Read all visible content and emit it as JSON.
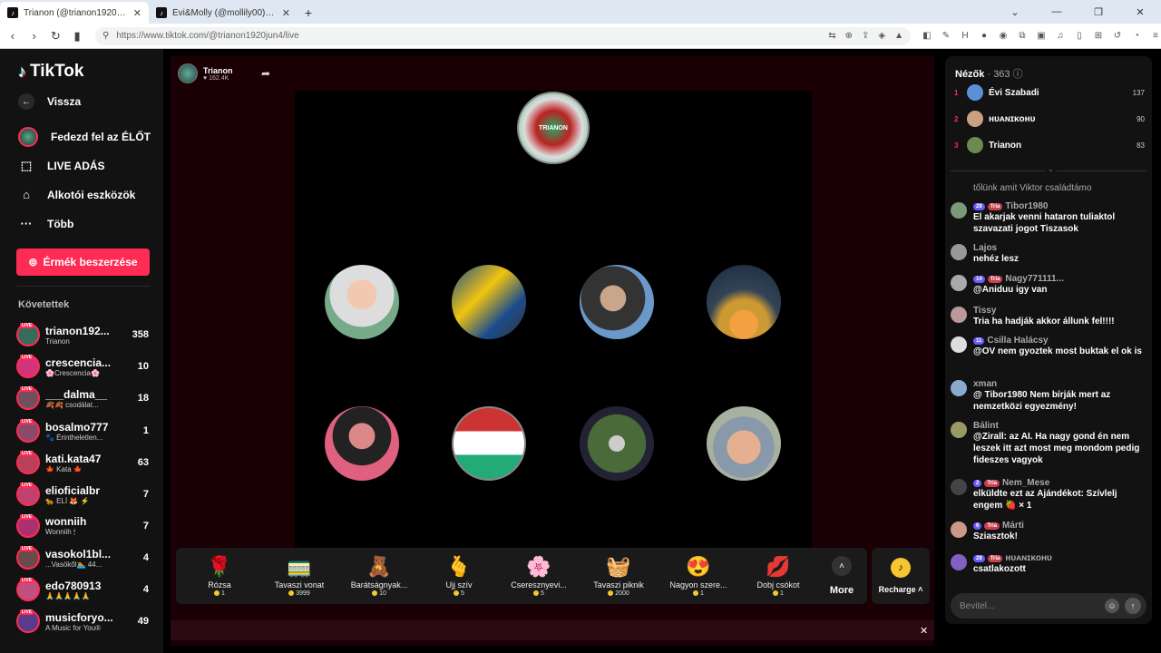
{
  "browser": {
    "tabs": [
      {
        "title": "Trianon (@trianon1920jun4) ÉLŐ adásban",
        "active": true
      },
      {
        "title": "Évi&Molly (@mollily00) ÉLŐ adásban",
        "active": false
      }
    ],
    "url": "https://www.tiktok.com/@trianon1920jun4/live"
  },
  "sidebar": {
    "brand": "TikTok",
    "nav": [
      {
        "label": "Vissza",
        "icon": "back-arrow-icon"
      },
      {
        "label": "Fedezd fel az ÉLŐT",
        "icon": "avatar-icon"
      },
      {
        "label": "LIVE ADÁS",
        "icon": "camera-icon"
      },
      {
        "label": "Alkotói eszközök",
        "icon": "play-icon"
      },
      {
        "label": "Több",
        "icon": "ellipsis-icon"
      }
    ],
    "coins_button": "Érmék beszerzése",
    "followed_title": "Követettek",
    "live_tag": "LIVE",
    "followed": [
      {
        "name": "trianon192...",
        "sub": "Trianon",
        "count": "358"
      },
      {
        "name": "crescencia...",
        "sub": "🌸Crescencia🌸",
        "count": "10"
      },
      {
        "name": "___dalma__",
        "sub": "🍂🍂 csodálat...",
        "count": "18"
      },
      {
        "name": "bosalmo777",
        "sub": "🐾 Érintheletlen...",
        "count": "1"
      },
      {
        "name": "kati.kata47",
        "sub": "🍁 Kata 🍁",
        "count": "63"
      },
      {
        "name": "elioficialbr",
        "sub": "🐆 ELÍ 🦊 ⚡",
        "count": "7"
      },
      {
        "name": "wonniih",
        "sub": "Wonniih 🕯",
        "count": "7"
      },
      {
        "name": "vasokol1bl...",
        "sub": "...Vasökől🏊 44...",
        "count": "4"
      },
      {
        "name": "edo780913",
        "sub": "🙏🙏🙏🙏🙏",
        "count": "4"
      },
      {
        "name": "musicforyo...",
        "sub": "A Music for You®",
        "count": "49"
      }
    ]
  },
  "stream": {
    "host_name": "Trianon",
    "host_likes": "162.4K",
    "emblem_text": "TRIANON"
  },
  "gifts": [
    {
      "name": "Rózsa",
      "price": "1",
      "icon": "🌹"
    },
    {
      "name": "Tavaszi vonat",
      "price": "3999",
      "icon": "🚃"
    },
    {
      "name": "Barátságnyak...",
      "price": "10",
      "icon": "🧸"
    },
    {
      "name": "Ujj szív",
      "price": "5",
      "icon": "🫰"
    },
    {
      "name": "Cseresznyevi...",
      "price": "5",
      "icon": "🌸"
    },
    {
      "name": "Tavaszi piknik",
      "price": "2000",
      "icon": "🧺"
    },
    {
      "name": "Nagyon szere...",
      "price": "1",
      "icon": "😍"
    },
    {
      "name": "Dobj csókot",
      "price": "1",
      "icon": "💋"
    }
  ],
  "gift_more": "More",
  "recharge": "Recharge",
  "viewers": {
    "title": "Nézők",
    "count": "· 363",
    "top": [
      {
        "rank": "1",
        "name": "Évi Szabadi",
        "score": "137",
        "color": "#5b8fd8"
      },
      {
        "rank": "2",
        "name": "ʜᴜᴀɴɪᴋᴏʜᴜ",
        "score": "90",
        "color": "#caa080"
      },
      {
        "rank": "3",
        "name": "Trianon",
        "score": "83",
        "color": "#6a8a50"
      }
    ]
  },
  "chat": {
    "top_snippet": "tőlünk amit Viktor családtámo",
    "messages": [
      {
        "user": "Tibor1980",
        "badges": [
          "28",
          "Tria"
        ],
        "text": "El akarjak venni hataron tuliaktol szavazati jogot Tiszasok",
        "color": "#7a9a7a"
      },
      {
        "user": "Lajos",
        "badges": [],
        "text": "nehéz lesz",
        "color": "#999"
      },
      {
        "user": "Nagy771111...",
        "badges": [
          "14",
          "Tria"
        ],
        "text": "@Aniduu igy van",
        "color": "#aaa"
      },
      {
        "user": "Tissy",
        "badges": [],
        "text": "Tria ha hadják akkor állunk fel!!!!",
        "color": "#b99"
      },
      {
        "user": "Csilla Halácsy",
        "badges": [
          "11"
        ],
        "text": "@OV nem gyoztek most buktak el ok is",
        "color": "#ddd"
      },
      {
        "user": "xman",
        "badges": [],
        "text": "@ Tibor1980 Nem bírják mert az nemzetközi egyezmény!",
        "color": "#8ac"
      },
      {
        "user": "Bálint",
        "badges": [],
        "text": "@Zirall: az AI. Ha nagy gond én nem leszek itt azt most meg mondom pedig fideszes vagyok",
        "color": "#996"
      },
      {
        "user": "Nem_Mese",
        "badges": [
          "2",
          "Tria"
        ],
        "text": "elküldte ezt az Ajándékot: Szívlelj engem 🍓 × 1",
        "color": "#444"
      },
      {
        "user": "Márti",
        "badges": [
          "6",
          "Tria"
        ],
        "text": "Sziasztok!",
        "color": "#c98"
      },
      {
        "user": "ʜᴜᴀɴɪᴋᴏʜᴜ",
        "badges": [
          "28",
          "Tria"
        ],
        "text": "csatlakozott",
        "color": "#8060c0"
      }
    ],
    "input_placeholder": "Bevitel..."
  }
}
